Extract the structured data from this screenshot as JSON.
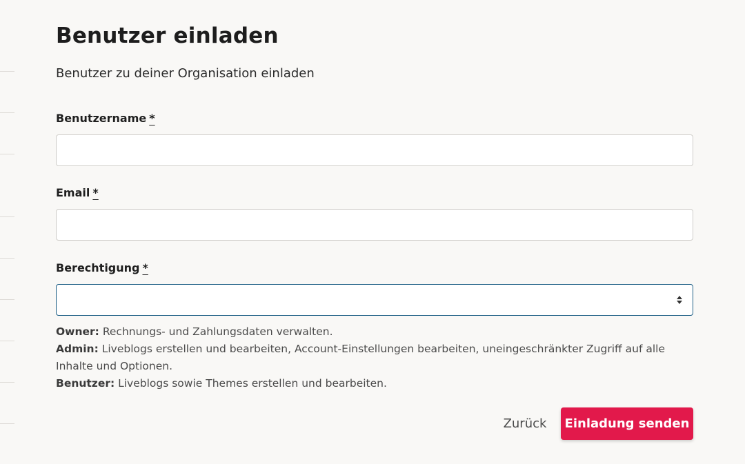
{
  "dialog": {
    "title": "Benutzer einladen",
    "subtitle": "Benutzer zu deiner Organisation einladen"
  },
  "fields": {
    "username": {
      "label": "Benutzername",
      "required_mark": "*",
      "value": "",
      "placeholder": ""
    },
    "email": {
      "label": "Email",
      "required_mark": "*",
      "value": "",
      "placeholder": ""
    },
    "permission": {
      "label": "Berechtigung",
      "required_mark": "*",
      "selected": ""
    }
  },
  "help": {
    "owner_title": "Owner:",
    "owner_text": " Rechnungs- und Zahlungsdaten verwalten.",
    "admin_title": "Admin:",
    "admin_text": " Liveblogs erstellen und bearbeiten, Account-Einstellungen bearbeiten, uneingeschränkter Zugriff auf alle Inhalte und Optionen.",
    "user_title": "Benutzer:",
    "user_text": " Liveblogs sowie Themes erstellen und bearbeiten."
  },
  "actions": {
    "back_label": "Zurück",
    "send_label": "Einladung senden"
  },
  "colors": {
    "primary": "#e2194b",
    "focus_border": "#1e5f86",
    "background": "#f9f8f6"
  },
  "icons": {
    "select_arrows": "sort-arrows-icon"
  }
}
